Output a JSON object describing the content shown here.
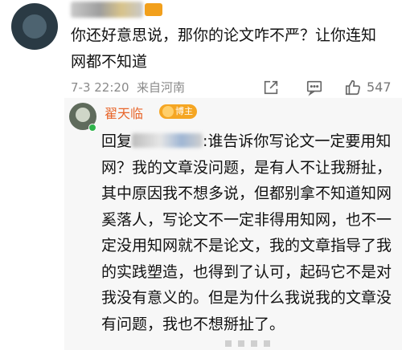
{
  "comment": {
    "text": "你还好意思说，那你的论文咋不严？让你连知网都不知道",
    "time": "7-3 22:20",
    "location": "来自河南",
    "like_count": "547"
  },
  "reply": {
    "username": "翟天临",
    "badge": "博主",
    "prefix": "回复",
    "text": ":谁告诉你写论文一定要用知网？我的文章没问题，是有人不让我掰扯，其中原因我不想多说，但都别拿不知道知网奚落人，写论文不一定非得用知网，也不一定没用知网就不是论文，我的文章指导了我的实践塑造，也得到了认可，起码它不是对我没有意义的。但是为什么我说我的文章没有问题，我也不想掰扯了。"
  },
  "icons": {
    "share": "share-icon",
    "comment": "comment-icon",
    "like": "thumbs-up-icon"
  }
}
